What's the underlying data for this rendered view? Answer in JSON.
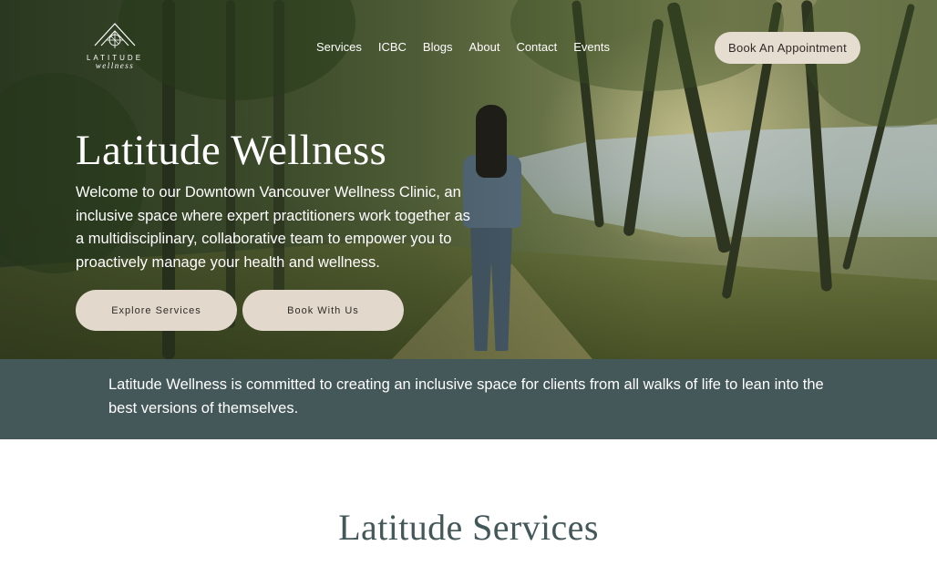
{
  "brand": {
    "logo_word": "LATITUDE",
    "logo_sub": "wellness"
  },
  "nav": {
    "items": [
      "Services",
      "ICBC",
      "Blogs",
      "About",
      "Contact",
      "Events"
    ],
    "cta_label": "Book An Appointment"
  },
  "hero": {
    "title": "Latitude Wellness",
    "description": "Welcome to our Downtown Vancouver Wellness Clinic, an inclusive space where expert practitioners work together as a multidisciplinary, collaborative team to empower you to proactively manage your health and wellness.",
    "primary_button": "Explore Services",
    "secondary_button": "Book With Us"
  },
  "mission": {
    "text": "Latitude Wellness is committed to creating an inclusive space for clients from all walks of life to lean into the best versions of themselves."
  },
  "services": {
    "title": "Latitude Services"
  },
  "colors": {
    "accent_dark": "#44585a",
    "button_beige": "#e2d8cc",
    "text_dark": "#2f2a26"
  }
}
